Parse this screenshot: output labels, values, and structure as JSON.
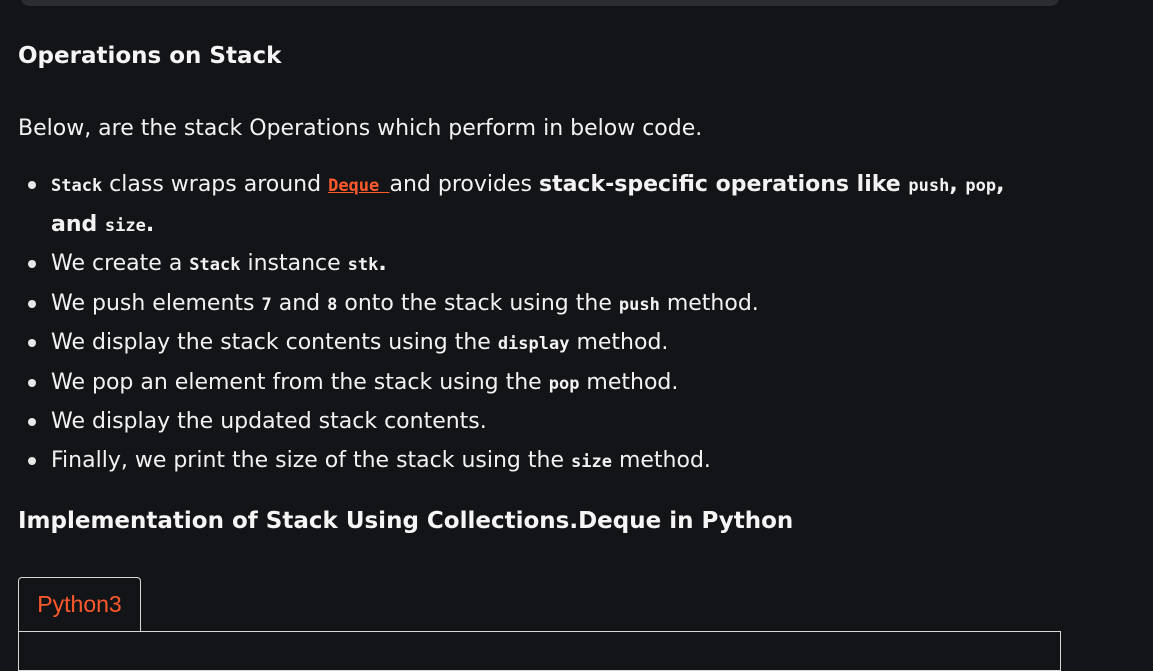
{
  "headings": {
    "operations": "Operations on Stack",
    "implementation": "Implementation of Stack Using Collections.Deque in Python"
  },
  "intro": "Below, are the stack Operations which perform in below code.",
  "bullets": {
    "b1": {
      "code_stack": "Stack",
      "text_a": " class wraps around ",
      "link_deque": "Deque ",
      "text_b": "and provides ",
      "bold_a": "stack-specific operations like ",
      "code_push": "push",
      "bold_b": ", ",
      "code_pop": "pop",
      "bold_c": ", and ",
      "code_size": "size",
      "bold_d": "."
    },
    "b2": {
      "text_a": "We create a ",
      "code_stack": "Stack",
      "text_b": " instance ",
      "code_stk": "stk",
      "bold_end": "."
    },
    "b3": {
      "text_a": "We push elements ",
      "code_7": "7",
      "text_b": " and ",
      "code_8": "8",
      "text_c": " onto the stack using the ",
      "code_push": "push",
      "text_d": " method."
    },
    "b4": {
      "text_a": "We display the stack contents using the ",
      "code_display": "display",
      "text_b": " method."
    },
    "b5": {
      "text_a": "We pop an element from the stack using the ",
      "code_pop": "pop",
      "text_b": " method."
    },
    "b6": {
      "text_a": "We display the updated stack contents."
    },
    "b7": {
      "text_a": "Finally, we print the size of the stack using the ",
      "code_size": "size",
      "text_b": " method."
    }
  },
  "code_tab": {
    "label": "Python3"
  }
}
